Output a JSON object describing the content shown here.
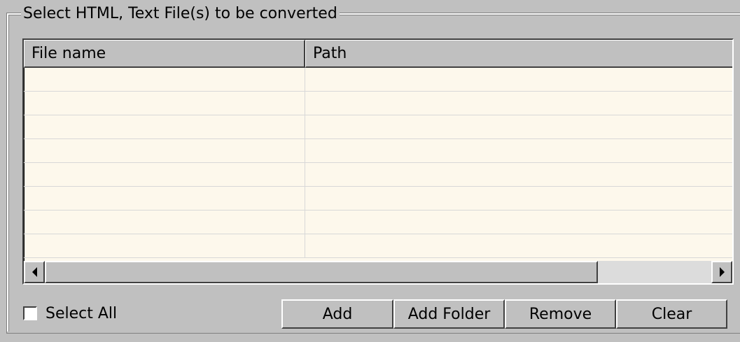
{
  "group": {
    "title": "Select HTML, Text File(s) to be converted"
  },
  "list": {
    "columns": [
      {
        "label": "File name"
      },
      {
        "label": "Path"
      }
    ],
    "rows": [
      {
        "file_name": "",
        "path": ""
      },
      {
        "file_name": "",
        "path": ""
      },
      {
        "file_name": "",
        "path": ""
      },
      {
        "file_name": "",
        "path": ""
      },
      {
        "file_name": "",
        "path": ""
      },
      {
        "file_name": "",
        "path": ""
      },
      {
        "file_name": "",
        "path": ""
      },
      {
        "file_name": "",
        "path": ""
      }
    ]
  },
  "select_all": {
    "label": "Select All",
    "checked": false
  },
  "buttons": {
    "add": "Add",
    "add_folder": "Add Folder",
    "remove": "Remove",
    "clear": "Clear"
  },
  "icons": {
    "scroll_left": "arrow-left-icon",
    "scroll_right": "arrow-right-icon"
  },
  "colors": {
    "window_bg": "#c0c0c0",
    "list_bg": "#fdf8ec"
  }
}
